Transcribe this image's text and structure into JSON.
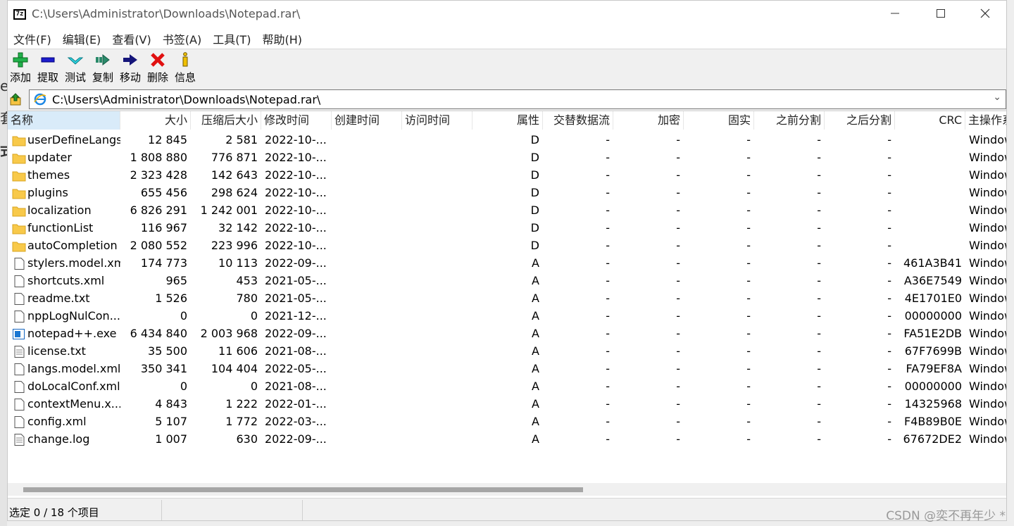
{
  "window": {
    "title": "C:\\Users\\Administrator\\Downloads\\Notepad.rar\\",
    "icon_text": "7z"
  },
  "menu": [
    "文件(F)",
    "编辑(E)",
    "查看(V)",
    "书签(A)",
    "工具(T)",
    "帮助(H)"
  ],
  "toolbar": [
    {
      "label": "添加",
      "icon": "add-icon"
    },
    {
      "label": "提取",
      "icon": "extract-icon"
    },
    {
      "label": "测试",
      "icon": "test-icon"
    },
    {
      "label": "复制",
      "icon": "copy-icon"
    },
    {
      "label": "移动",
      "icon": "move-icon"
    },
    {
      "label": "删除",
      "icon": "delete-icon"
    },
    {
      "label": "信息",
      "icon": "info-icon"
    }
  ],
  "address": "C:\\Users\\Administrator\\Downloads\\Notepad.rar\\",
  "columns": [
    "名称",
    "大小",
    "压缩后大小",
    "修改时间",
    "创建时间",
    "访问时间",
    "属性",
    "交替数据流",
    "加密",
    "固实",
    "之前分割",
    "之后分割",
    "CRC",
    "主操作系统"
  ],
  "files": [
    {
      "name": "userDefineLangs",
      "type": "folder",
      "size": "12 845",
      "packed": "2 581",
      "modified": "2022-10-...",
      "attr": "D",
      "ads": "-",
      "enc": "-",
      "solid": "-",
      "split_before": "-",
      "split_after": "-",
      "crc": "",
      "os": "Windows"
    },
    {
      "name": "updater",
      "type": "folder",
      "size": "1 808 880",
      "packed": "776 871",
      "modified": "2022-10-...",
      "attr": "D",
      "ads": "-",
      "enc": "-",
      "solid": "-",
      "split_before": "-",
      "split_after": "-",
      "crc": "",
      "os": "Windows"
    },
    {
      "name": "themes",
      "type": "folder",
      "size": "2 323 428",
      "packed": "142 643",
      "modified": "2022-10-...",
      "attr": "D",
      "ads": "-",
      "enc": "-",
      "solid": "-",
      "split_before": "-",
      "split_after": "-",
      "crc": "",
      "os": "Windows"
    },
    {
      "name": "plugins",
      "type": "folder",
      "size": "655 456",
      "packed": "298 624",
      "modified": "2022-10-...",
      "attr": "D",
      "ads": "-",
      "enc": "-",
      "solid": "-",
      "split_before": "-",
      "split_after": "-",
      "crc": "",
      "os": "Windows"
    },
    {
      "name": "localization",
      "type": "folder",
      "size": "6 826 291",
      "packed": "1 242 001",
      "modified": "2022-10-...",
      "attr": "D",
      "ads": "-",
      "enc": "-",
      "solid": "-",
      "split_before": "-",
      "split_after": "-",
      "crc": "",
      "os": "Windows"
    },
    {
      "name": "functionList",
      "type": "folder",
      "size": "116 967",
      "packed": "32 142",
      "modified": "2022-10-...",
      "attr": "D",
      "ads": "-",
      "enc": "-",
      "solid": "-",
      "split_before": "-",
      "split_after": "-",
      "crc": "",
      "os": "Windows"
    },
    {
      "name": "autoCompletion",
      "type": "folder",
      "size": "2 080 552",
      "packed": "223 996",
      "modified": "2022-10-...",
      "attr": "D",
      "ads": "-",
      "enc": "-",
      "solid": "-",
      "split_before": "-",
      "split_after": "-",
      "crc": "",
      "os": "Windows"
    },
    {
      "name": "stylers.model.xml",
      "type": "file",
      "size": "174 773",
      "packed": "10 113",
      "modified": "2022-09-...",
      "attr": "A",
      "ads": "-",
      "enc": "-",
      "solid": "-",
      "split_before": "-",
      "split_after": "-",
      "crc": "461A3B41",
      "os": "Windows"
    },
    {
      "name": "shortcuts.xml",
      "type": "file",
      "size": "965",
      "packed": "453",
      "modified": "2021-05-...",
      "attr": "A",
      "ads": "-",
      "enc": "-",
      "solid": "-",
      "split_before": "-",
      "split_after": "-",
      "crc": "A36E7549",
      "os": "Windows"
    },
    {
      "name": "readme.txt",
      "type": "file",
      "size": "1 526",
      "packed": "780",
      "modified": "2021-05-...",
      "attr": "A",
      "ads": "-",
      "enc": "-",
      "solid": "-",
      "split_before": "-",
      "split_after": "-",
      "crc": "4E1701E0",
      "os": "Windows"
    },
    {
      "name": "nppLogNulCon...",
      "type": "file",
      "size": "0",
      "packed": "0",
      "modified": "2021-12-...",
      "attr": "A",
      "ads": "-",
      "enc": "-",
      "solid": "-",
      "split_before": "-",
      "split_after": "-",
      "crc": "00000000",
      "os": "Windows"
    },
    {
      "name": "notepad++.exe",
      "type": "exe",
      "size": "6 434 840",
      "packed": "2 003 968",
      "modified": "2022-09-...",
      "attr": "A",
      "ads": "-",
      "enc": "-",
      "solid": "-",
      "split_before": "-",
      "split_after": "-",
      "crc": "FA51E2DB",
      "os": "Windows"
    },
    {
      "name": "license.txt",
      "type": "text",
      "size": "35 500",
      "packed": "11 606",
      "modified": "2021-08-...",
      "attr": "A",
      "ads": "-",
      "enc": "-",
      "solid": "-",
      "split_before": "-",
      "split_after": "-",
      "crc": "67F7699B",
      "os": "Windows"
    },
    {
      "name": "langs.model.xml",
      "type": "file",
      "size": "350 341",
      "packed": "104 404",
      "modified": "2022-05-...",
      "attr": "A",
      "ads": "-",
      "enc": "-",
      "solid": "-",
      "split_before": "-",
      "split_after": "-",
      "crc": "FA79EF8A",
      "os": "Windows"
    },
    {
      "name": "doLocalConf.xml",
      "type": "file",
      "size": "0",
      "packed": "0",
      "modified": "2021-08-...",
      "attr": "A",
      "ads": "-",
      "enc": "-",
      "solid": "-",
      "split_before": "-",
      "split_after": "-",
      "crc": "00000000",
      "os": "Windows"
    },
    {
      "name": "contextMenu.x...",
      "type": "file",
      "size": "4 843",
      "packed": "1 222",
      "modified": "2022-01-...",
      "attr": "A",
      "ads": "-",
      "enc": "-",
      "solid": "-",
      "split_before": "-",
      "split_after": "-",
      "crc": "14325968",
      "os": "Windows"
    },
    {
      "name": "config.xml",
      "type": "file",
      "size": "5 107",
      "packed": "1 772",
      "modified": "2022-03-...",
      "attr": "A",
      "ads": "-",
      "enc": "-",
      "solid": "-",
      "split_before": "-",
      "split_after": "-",
      "crc": "F4B89B0E",
      "os": "Windows"
    },
    {
      "name": "change.log",
      "type": "text",
      "size": "1 007",
      "packed": "630",
      "modified": "2022-09-...",
      "attr": "A",
      "ads": "-",
      "enc": "-",
      "solid": "-",
      "split_before": "-",
      "split_after": "-",
      "crc": "67672DE2",
      "os": "Windows"
    }
  ],
  "status": {
    "selection": "选定 0 / 18 个项目"
  },
  "watermark": "CSDN @奕不再年少 *",
  "colors": {
    "header_selected": "#d9ebf9",
    "folder": "#f8c94a",
    "scroll_thumb": "#a6a6a6"
  }
}
